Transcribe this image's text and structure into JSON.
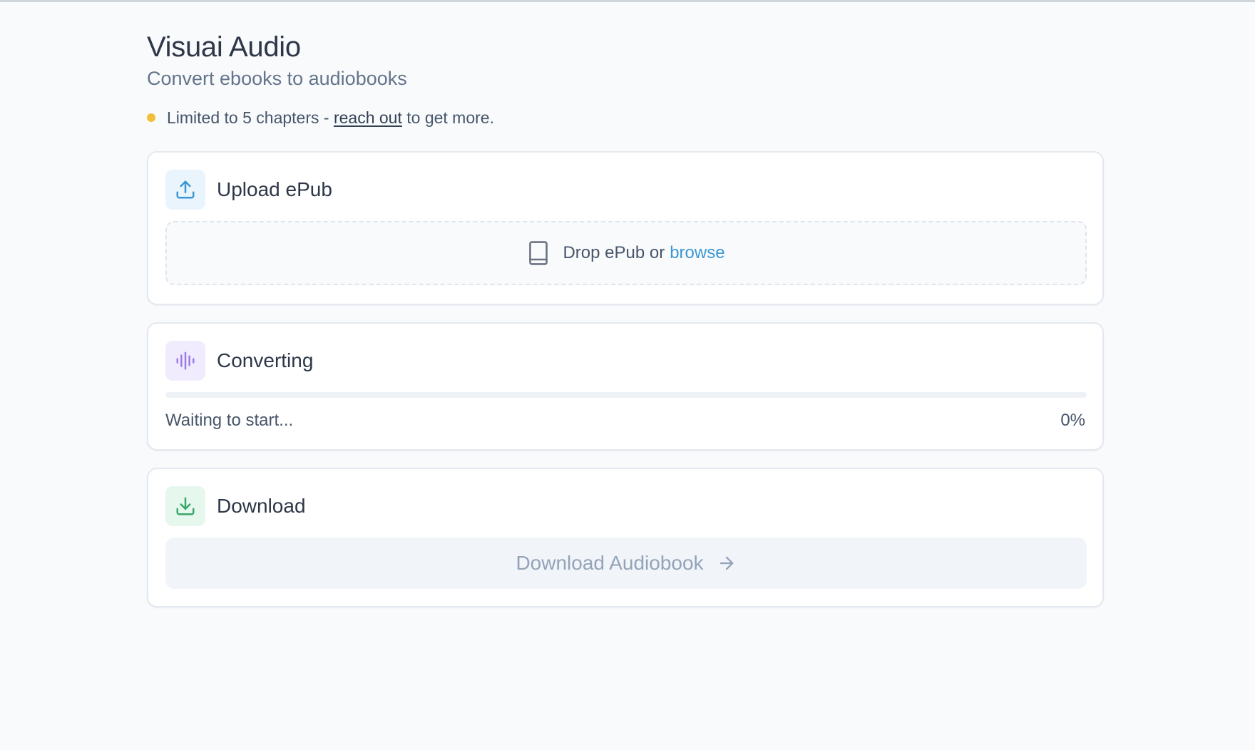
{
  "app": {
    "title": "Visuai Audio",
    "subtitle": "Convert ebooks to audiobooks"
  },
  "notice": {
    "prefix": "Limited to 5 chapters -",
    "link_text": "reach out",
    "suffix": "to get more.",
    "dot_color": "#f3bf3a"
  },
  "upload": {
    "title": "Upload ePub",
    "icon": "upload-icon",
    "drop_text": "Drop ePub or",
    "browse_label": "browse",
    "drop_icon": "book-icon"
  },
  "converting": {
    "title": "Converting",
    "icon": "audio-waveform-icon",
    "status": "Waiting to start...",
    "percent_label": "0%",
    "progress": 0
  },
  "download": {
    "title": "Download",
    "icon": "download-icon",
    "button_label": "Download Audiobook",
    "button_icon": "arrow-right-icon",
    "button_enabled": false
  },
  "colors": {
    "accent_blue": "#3b97d3",
    "accent_purple": "#9b7be6",
    "accent_green": "#3aa86b"
  }
}
